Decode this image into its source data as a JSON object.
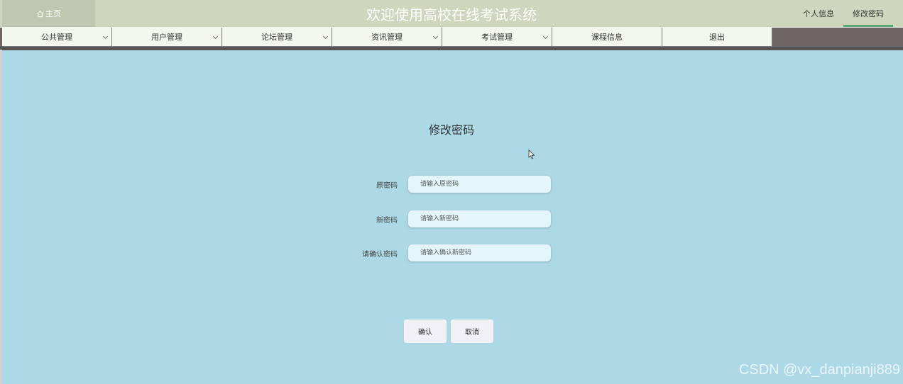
{
  "header": {
    "home_label": "主页",
    "title": "欢迎使用高校在线考试系统",
    "links": [
      {
        "label": "个人信息",
        "active": false
      },
      {
        "label": "修改密码",
        "active": true
      }
    ]
  },
  "nav": {
    "items": [
      {
        "label": "公共管理",
        "dropdown": true
      },
      {
        "label": "用户管理",
        "dropdown": true
      },
      {
        "label": "论坛管理",
        "dropdown": true
      },
      {
        "label": "资讯管理",
        "dropdown": true
      },
      {
        "label": "考试管理",
        "dropdown": true
      },
      {
        "label": "课程信息",
        "dropdown": false
      },
      {
        "label": "退出",
        "dropdown": false
      }
    ]
  },
  "form": {
    "title": "修改密码",
    "fields": [
      {
        "label": "原密码",
        "placeholder": "请输入原密码",
        "value": ""
      },
      {
        "label": "新密码",
        "placeholder": "请输入新密码",
        "value": ""
      },
      {
        "label": "请确认密码",
        "placeholder": "请输入确认新密码",
        "value": ""
      }
    ],
    "confirm_label": "确认",
    "cancel_label": "取消"
  },
  "watermark": "CSDN @vx_danpianji889",
  "colors": {
    "header_bg": "#cfd6be",
    "home_bg": "#c1c6b0",
    "nav_item_bg": "#f3f7ed",
    "nav_bar_bg": "#6e6565",
    "content_bg": "#add8e6",
    "input_bg": "#e4f6fb",
    "active_underline": "#5aa87a"
  }
}
